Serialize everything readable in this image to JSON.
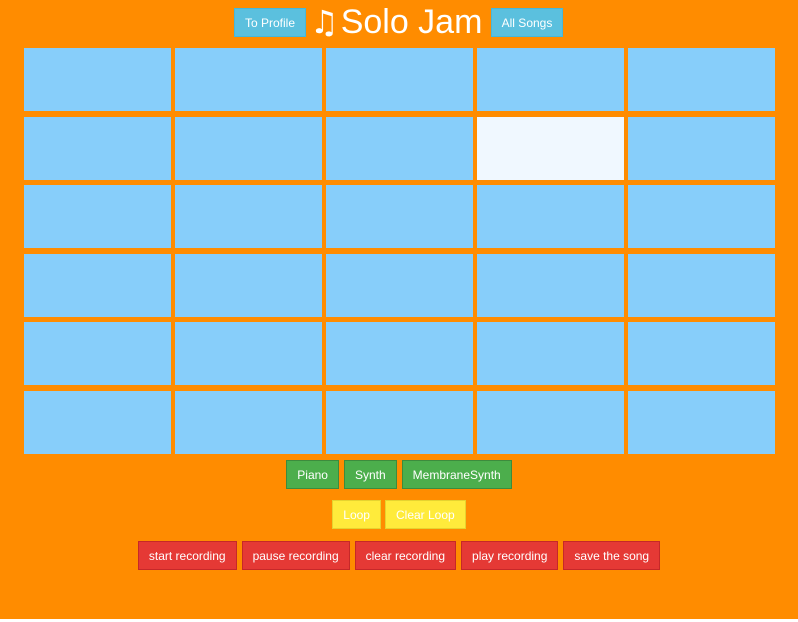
{
  "header": {
    "profile_label": "To Profile",
    "title_icon": "♫",
    "title": "Solo Jam",
    "songs_label": "All Songs"
  },
  "pads": {
    "rows": 6,
    "columns": 5,
    "active": [
      [
        1,
        3
      ]
    ]
  },
  "instruments": {
    "piano": "Piano",
    "synth": "Synth",
    "membrane": "MembraneSynth"
  },
  "loop": {
    "loop": "Loop",
    "clear": "Clear Loop"
  },
  "recording": {
    "start": "start recording",
    "pause": "pause recording",
    "clear": "clear recording",
    "play": "play recording",
    "save": "save the song"
  },
  "colors": {
    "background": "#ff8c00",
    "pad": "#87cefa",
    "pad_active": "#f0f8ff",
    "nav": "#5bc0de",
    "green": "#4cae4c",
    "yellow": "#ffeb3b",
    "red": "#e53935"
  }
}
